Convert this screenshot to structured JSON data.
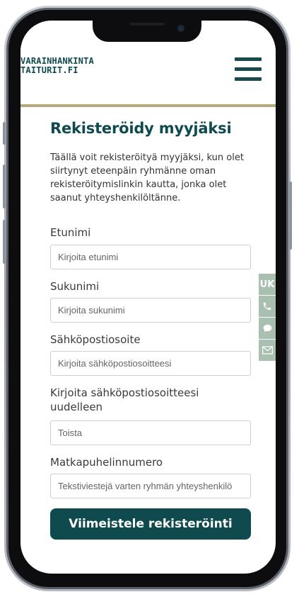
{
  "brand": {
    "line1": "VARAINHANKINTA",
    "line2": "TAITURIT.FI"
  },
  "menu_icon": "hamburger-menu-icon",
  "form": {
    "title": "Rekisteröidy myyjäksi",
    "intro": "Täällä voit rekisteröityä myyjäksi, kun olet siirtynyt eteenpäin ryhmänne oman rekisteröitymislinkin kautta, jonka olet saanut yhteyshenkilöltänne.",
    "first_name": {
      "label": "Etunimi",
      "placeholder": "Kirjoita etunimi"
    },
    "last_name": {
      "label": "Sukunimi",
      "placeholder": "Kirjoita sukunimi"
    },
    "email": {
      "label": "Sähköpostiosoite",
      "placeholder": "Kirjoita sähköpostiosoitteesi"
    },
    "email_repeat": {
      "label_line1": "Kirjoita sähköpostiosoitteesi",
      "label_line2": "uudelleen",
      "placeholder": "Toista"
    },
    "phone": {
      "label": "Matkapuhelinnumero",
      "placeholder": "Tekstiviestejä varten ryhmän yhteyshenkilö"
    },
    "submit_label": "Viimeistele rekisteröinti"
  },
  "side_tabs": {
    "faq_label": "UK",
    "icons": [
      "phone-icon",
      "chat-icon",
      "mail-icon"
    ]
  },
  "colors": {
    "brand": "#0f4a4f",
    "accent_line": "#b8a77c",
    "side_tab": "#a9bfb0"
  }
}
